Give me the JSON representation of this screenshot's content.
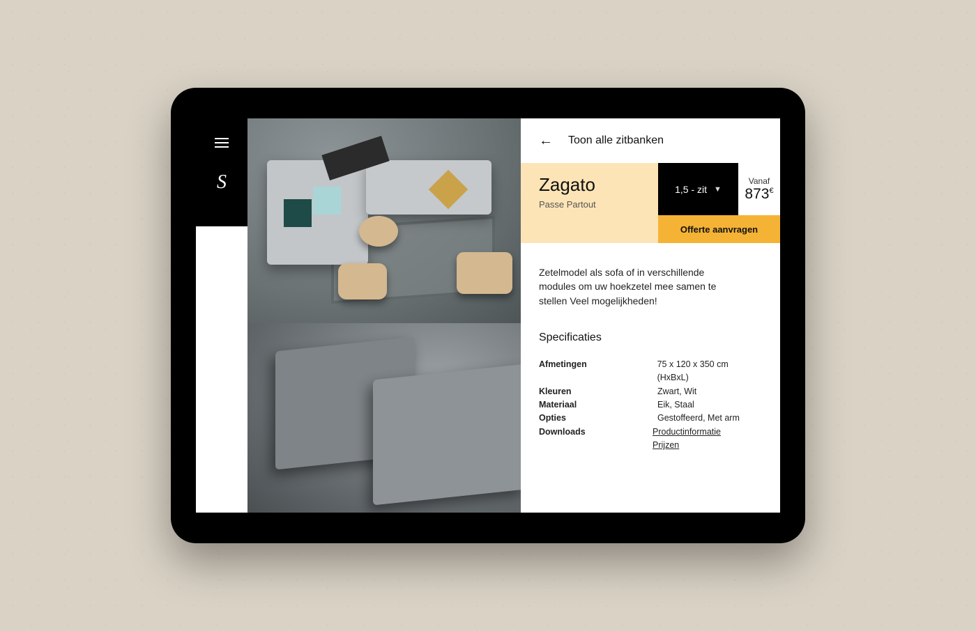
{
  "sidebar": {
    "logo": "S"
  },
  "back": {
    "label": "Toon alle zitbanken"
  },
  "product": {
    "name": "Zagato",
    "brand": "Passe Partout",
    "variant_selected": "1,5 - zit",
    "price_from_label": "Vanaf",
    "price_value": "873",
    "price_currency": "€",
    "cta": "Offerte aanvragen",
    "description": "Zetelmodel als sofa of in verschillende modules om uw hoekzetel mee samen te stellen Veel mogelijkheden!"
  },
  "specs": {
    "heading": "Specificaties",
    "rows": [
      {
        "k": "Afmetingen",
        "v": "75 x 120 x 350 cm (HxBxL)"
      },
      {
        "k": "Kleuren",
        "v": "Zwart, Wit"
      },
      {
        "k": "Materiaal",
        "v": "Eik, Staal"
      },
      {
        "k": "Opties",
        "v": "Gestoffeerd, Met arm"
      }
    ],
    "downloads_label": "Downloads",
    "downloads": [
      {
        "label": "Productinformatie"
      },
      {
        "label": "Prijzen"
      }
    ]
  }
}
